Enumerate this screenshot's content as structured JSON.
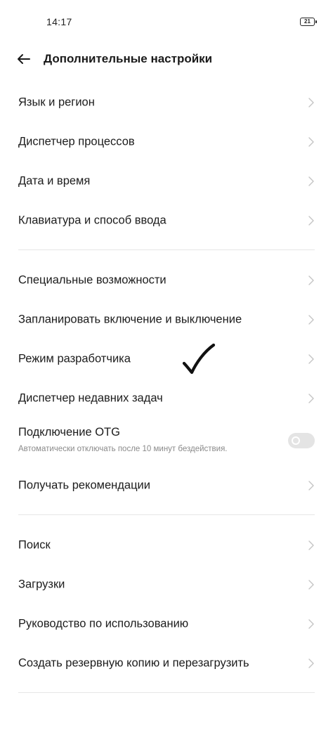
{
  "status_bar": {
    "time": "14:17",
    "battery": "21"
  },
  "header": {
    "title": "Дополнительные настройки",
    "back_icon": "arrow-left-icon"
  },
  "groups": [
    {
      "items": [
        {
          "label": "Язык и регион"
        },
        {
          "label": "Диспетчер процессов"
        },
        {
          "label": "Дата и время"
        },
        {
          "label": "Клавиатура и способ ввода"
        }
      ]
    },
    {
      "items": [
        {
          "label": "Специальные возможности"
        },
        {
          "label": "Запланировать включение и выключение"
        },
        {
          "label": "Режим разработчика"
        },
        {
          "label": "Диспетчер недавних задач"
        }
      ],
      "otg": {
        "title": "Подключение OTG",
        "subtitle": "Автоматически отключать после 10 минут бездействия.",
        "enabled": false
      },
      "after_otg": [
        {
          "label": "Получать рекомендации"
        }
      ]
    },
    {
      "items": [
        {
          "label": "Поиск"
        },
        {
          "label": "Загрузки"
        },
        {
          "label": "Руководство по использованию"
        },
        {
          "label": "Создать резервную копию и перезагрузить"
        }
      ]
    }
  ],
  "icons": {
    "chevron": "chevron-right-icon",
    "annotation": "handwritten-checkmark-icon"
  },
  "colors": {
    "text": "#1c1c1c",
    "subtext": "#8a8a8a",
    "chevron": "#c4c4c4",
    "divider": "#e6e6e6",
    "toggle_off": "#e4e4e4"
  }
}
